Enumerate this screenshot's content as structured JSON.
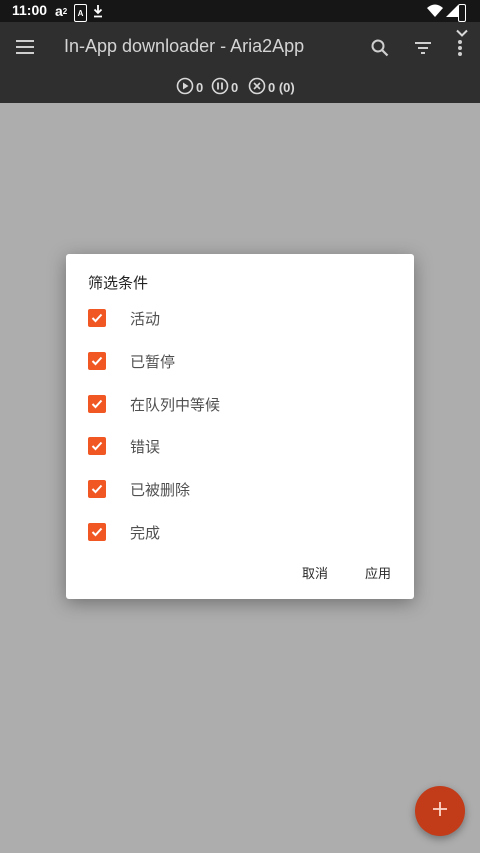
{
  "status_bar": {
    "time": "11:00",
    "a2_label": "a",
    "a2_sup": "2",
    "box_label": "A",
    "icons": [
      "a2-app-icon",
      "a-box-icon",
      "download-icon",
      "wifi-icon",
      "signal-icon",
      "battery-icon"
    ]
  },
  "app_bar": {
    "title": "In-App downloader - Aria2App",
    "actions": [
      "search-icon",
      "filter-icon",
      "more-vert-icon"
    ],
    "counters": {
      "active": "0",
      "paused": "0",
      "error": "0 (0)"
    }
  },
  "dialog": {
    "title": "筛选条件",
    "options": [
      {
        "label": "活动",
        "checked": true
      },
      {
        "label": "已暂停",
        "checked": true
      },
      {
        "label": "在队列中等候",
        "checked": true
      },
      {
        "label": "错误",
        "checked": true
      },
      {
        "label": "已被删除",
        "checked": true
      },
      {
        "label": "完成",
        "checked": true
      }
    ],
    "cancel_label": "取消",
    "apply_label": "应用"
  },
  "colors": {
    "accent": "#f05722",
    "fab": "#c23c1a",
    "app_bar": "#2f2f2f",
    "scrim": "#adadad"
  }
}
